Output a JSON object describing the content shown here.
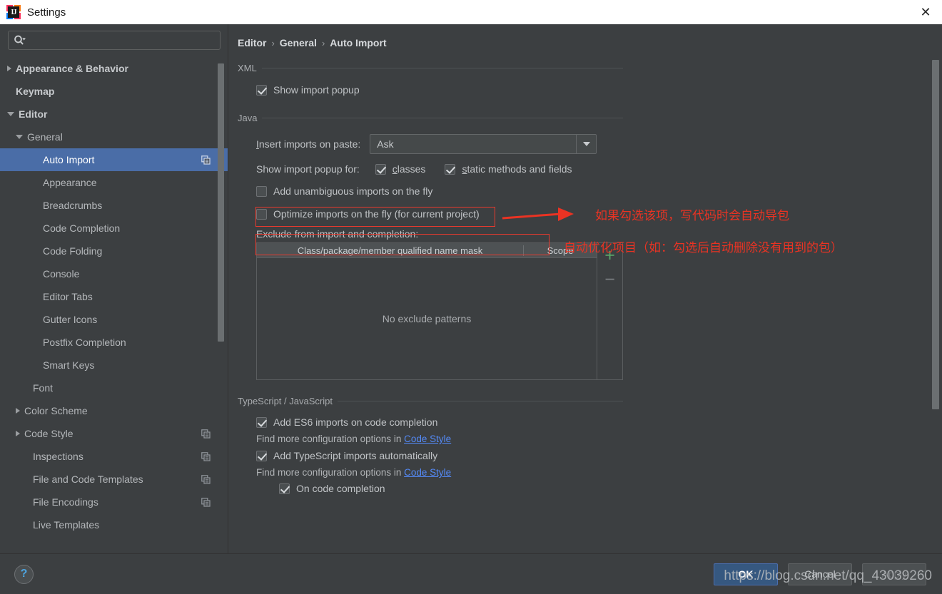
{
  "window": {
    "title": "Settings",
    "logo_icon": "intellij-idea-logo",
    "close_icon": "close-icon",
    "logo_text": "IJ"
  },
  "sidebar": {
    "search": {
      "placeholder": "",
      "value": "",
      "icon": "search-icon"
    },
    "items": [
      {
        "label": "Appearance & Behavior",
        "indent": 0,
        "arrow": "collapsed",
        "bold": true,
        "selected": false,
        "copy": false
      },
      {
        "label": "Keymap",
        "indent": 1,
        "arrow": "none",
        "bold": true,
        "selected": false,
        "copy": false
      },
      {
        "label": "Editor",
        "indent": 0,
        "arrow": "expanded",
        "bold": true,
        "selected": false,
        "copy": false
      },
      {
        "label": "General",
        "indent": 1,
        "arrow": "expanded",
        "bold": false,
        "selected": false,
        "copy": false
      },
      {
        "label": "Auto Import",
        "indent": 3,
        "arrow": "none",
        "bold": false,
        "selected": true,
        "copy": true
      },
      {
        "label": "Appearance",
        "indent": 3,
        "arrow": "none",
        "bold": false,
        "selected": false,
        "copy": false
      },
      {
        "label": "Breadcrumbs",
        "indent": 3,
        "arrow": "none",
        "bold": false,
        "selected": false,
        "copy": false
      },
      {
        "label": "Code Completion",
        "indent": 3,
        "arrow": "none",
        "bold": false,
        "selected": false,
        "copy": false
      },
      {
        "label": "Code Folding",
        "indent": 3,
        "arrow": "none",
        "bold": false,
        "selected": false,
        "copy": false
      },
      {
        "label": "Console",
        "indent": 3,
        "arrow": "none",
        "bold": false,
        "selected": false,
        "copy": false
      },
      {
        "label": "Editor Tabs",
        "indent": 3,
        "arrow": "none",
        "bold": false,
        "selected": false,
        "copy": false
      },
      {
        "label": "Gutter Icons",
        "indent": 3,
        "arrow": "none",
        "bold": false,
        "selected": false,
        "copy": false
      },
      {
        "label": "Postfix Completion",
        "indent": 3,
        "arrow": "none",
        "bold": false,
        "selected": false,
        "copy": false
      },
      {
        "label": "Smart Keys",
        "indent": 3,
        "arrow": "none",
        "bold": false,
        "selected": false,
        "copy": false
      },
      {
        "label": "Font",
        "indent": 2,
        "arrow": "none",
        "bold": false,
        "selected": false,
        "copy": false
      },
      {
        "label": "Color Scheme",
        "indent": 1,
        "arrow": "collapsed",
        "bold": false,
        "selected": false,
        "copy": false
      },
      {
        "label": "Code Style",
        "indent": 1,
        "arrow": "collapsed",
        "bold": false,
        "selected": false,
        "copy": true
      },
      {
        "label": "Inspections",
        "indent": 2,
        "arrow": "none",
        "bold": false,
        "selected": false,
        "copy": true
      },
      {
        "label": "File and Code Templates",
        "indent": 2,
        "arrow": "none",
        "bold": false,
        "selected": false,
        "copy": true
      },
      {
        "label": "File Encodings",
        "indent": 2,
        "arrow": "none",
        "bold": false,
        "selected": false,
        "copy": true
      },
      {
        "label": "Live Templates",
        "indent": 2,
        "arrow": "none",
        "bold": false,
        "selected": false,
        "copy": false
      }
    ]
  },
  "breadcrumb": {
    "part1": "Editor",
    "part2": "General",
    "part3": "Auto Import",
    "sep": "›"
  },
  "xml": {
    "title": "XML",
    "show_import_popup": {
      "label": "Show import popup",
      "checked": true
    }
  },
  "java": {
    "title": "Java",
    "insert_imports_label": "Insert imports on paste:",
    "insert_imports_mnemonic": "I",
    "insert_imports_rest": "nsert imports on paste:",
    "insert_imports_value": "Ask",
    "show_popup_for_label": "Show import popup for:",
    "classes": {
      "mnemonic": "c",
      "rest": "lasses",
      "checked": true
    },
    "static_methods": {
      "mnemonic": "s",
      "rest": "tatic methods and fields",
      "checked": true
    },
    "add_unambiguous": {
      "label": "Add unambiguous imports on the fly",
      "checked": false
    },
    "optimize_imports": {
      "label": "Optimize imports on the fly (for current project)",
      "checked": false
    },
    "exclude_label": "Exclude from import and completion:",
    "table": {
      "col1": "Class/package/member qualified name mask",
      "col2": "Scope",
      "empty_text": "No exclude patterns",
      "rows": [],
      "add_button": "+",
      "remove_button": "−"
    }
  },
  "typescript": {
    "title": "TypeScript / JavaScript",
    "add_es6": {
      "label": "Add ES6 imports on code completion",
      "checked": true
    },
    "note1_prefix": "Find more configuration options in ",
    "note1_link": "Code Style",
    "add_ts": {
      "label": "Add TypeScript imports automatically",
      "checked": true
    },
    "note2_prefix": "Find more configuration options in ",
    "note2_link": "Code Style",
    "on_code_completion": {
      "label": "On code completion",
      "checked": true
    }
  },
  "annotations": {
    "note1": "如果勾选该项，写代码时会自动导包",
    "note2": "自动优化项目（如：勾选后自动删除没有用到的包）",
    "color": "#ea3323"
  },
  "footer": {
    "help_label": "?",
    "ok": "OK",
    "cancel": "Cancel",
    "apply": "Apply",
    "watermark": "https://blog.csdn.net/qq_43039260"
  }
}
